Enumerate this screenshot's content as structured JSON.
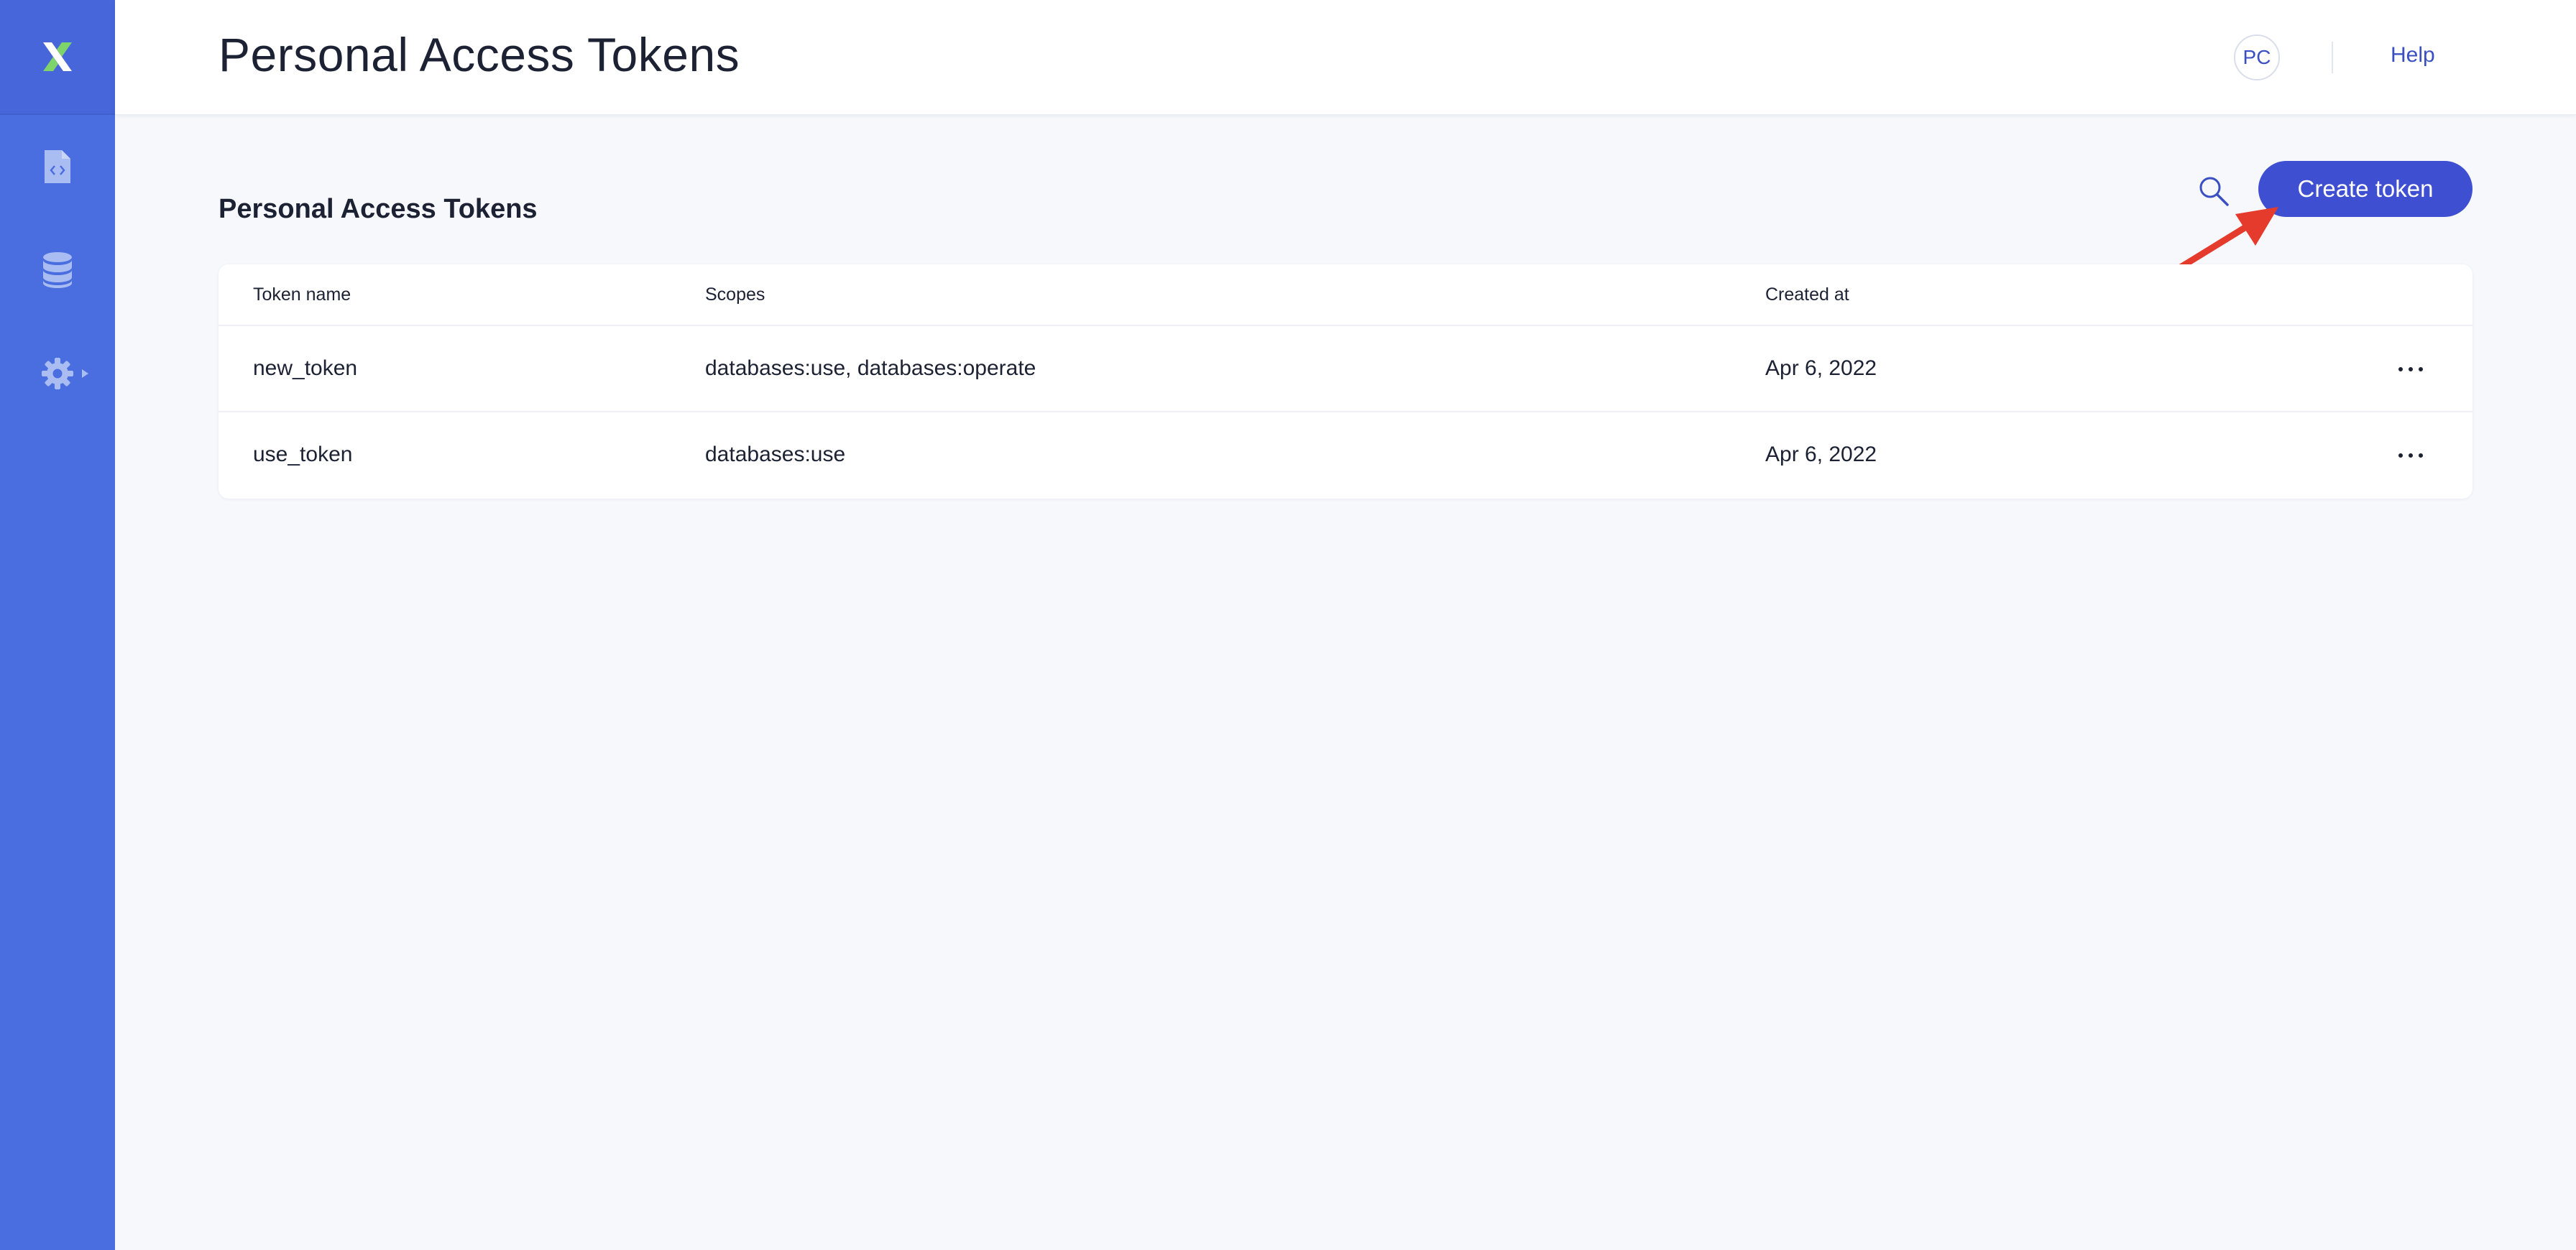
{
  "colors": {
    "sidebar": "#4a6ee0",
    "accent": "#3f4fd1",
    "link": "#3b4fc4",
    "annotation_arrow": "#e43b2c"
  },
  "sidebar": {
    "logo_icon": "x-logo-icon",
    "items": [
      {
        "name": "docs",
        "icon": "code-file-icon"
      },
      {
        "name": "databases",
        "icon": "database-icon"
      },
      {
        "name": "settings",
        "icon": "gear-icon"
      }
    ]
  },
  "header": {
    "title": "Personal Access Tokens",
    "avatar_initials": "PC",
    "help_label": "Help"
  },
  "main": {
    "section_title": "Personal Access Tokens",
    "search_icon": "search-icon",
    "create_button_label": "Create token"
  },
  "table": {
    "columns": [
      "Token name",
      "Scopes",
      "Created at"
    ],
    "rows": [
      {
        "name": "new_token",
        "scopes": "databases:use, databases:operate",
        "created_at": "Apr 6, 2022"
      },
      {
        "name": "use_token",
        "scopes": "databases:use",
        "created_at": "Apr 6, 2022"
      }
    ]
  }
}
